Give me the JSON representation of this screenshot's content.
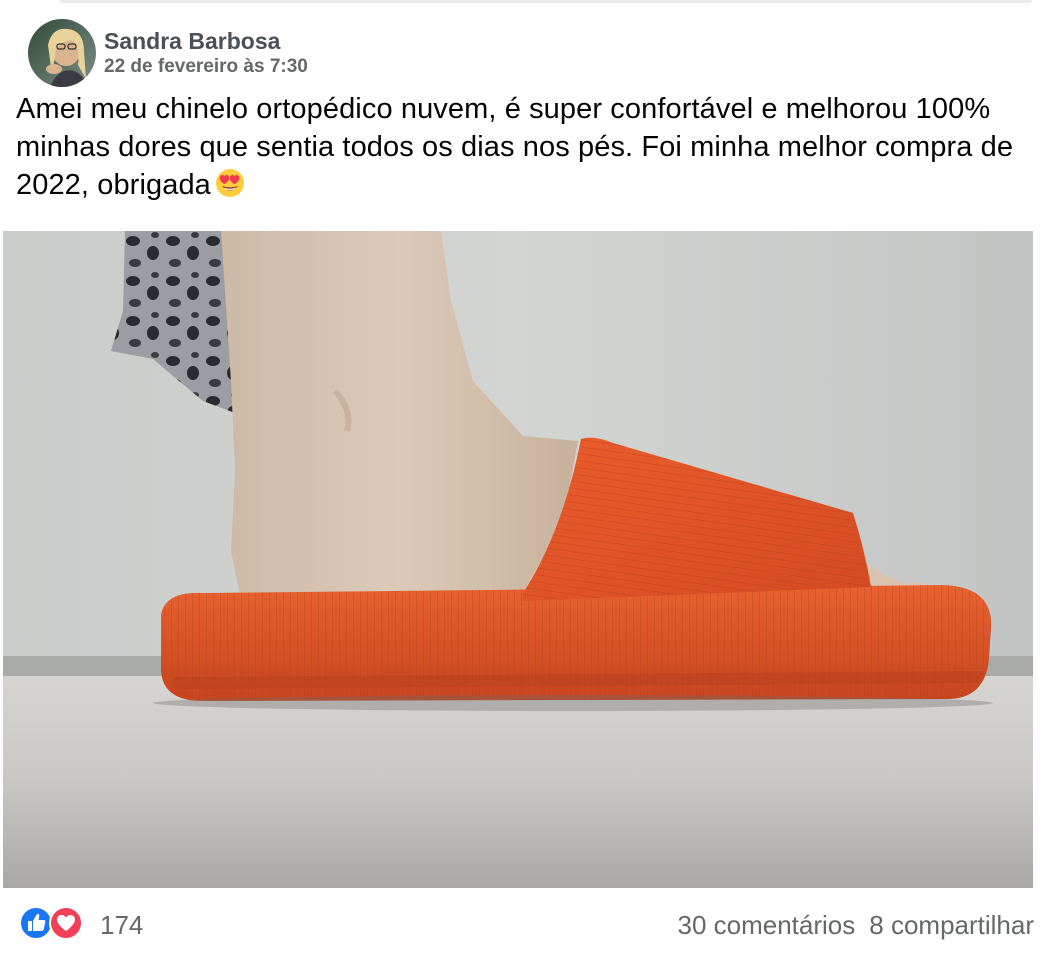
{
  "post": {
    "author": "Sandra Barbosa",
    "timestamp": "22 de fevereiro às 7:30",
    "text": "Amei meu chinelo ortopédico nuvem, é super confortável e melhorou 100% minhas dores que sentia todos os dias nos pés. Foi minha melhor compra de 2022, obrigada",
    "emoji": "smiling-face-with-heart-eyes"
  },
  "footer": {
    "reaction_count": "174",
    "comments": "30 comentários",
    "shares": "8 compartilhar"
  },
  "colors": {
    "like_blue": "#1877f2",
    "love_red": "#f33e58",
    "slide_orange": "#e2552b",
    "muted_text": "#65676b"
  }
}
